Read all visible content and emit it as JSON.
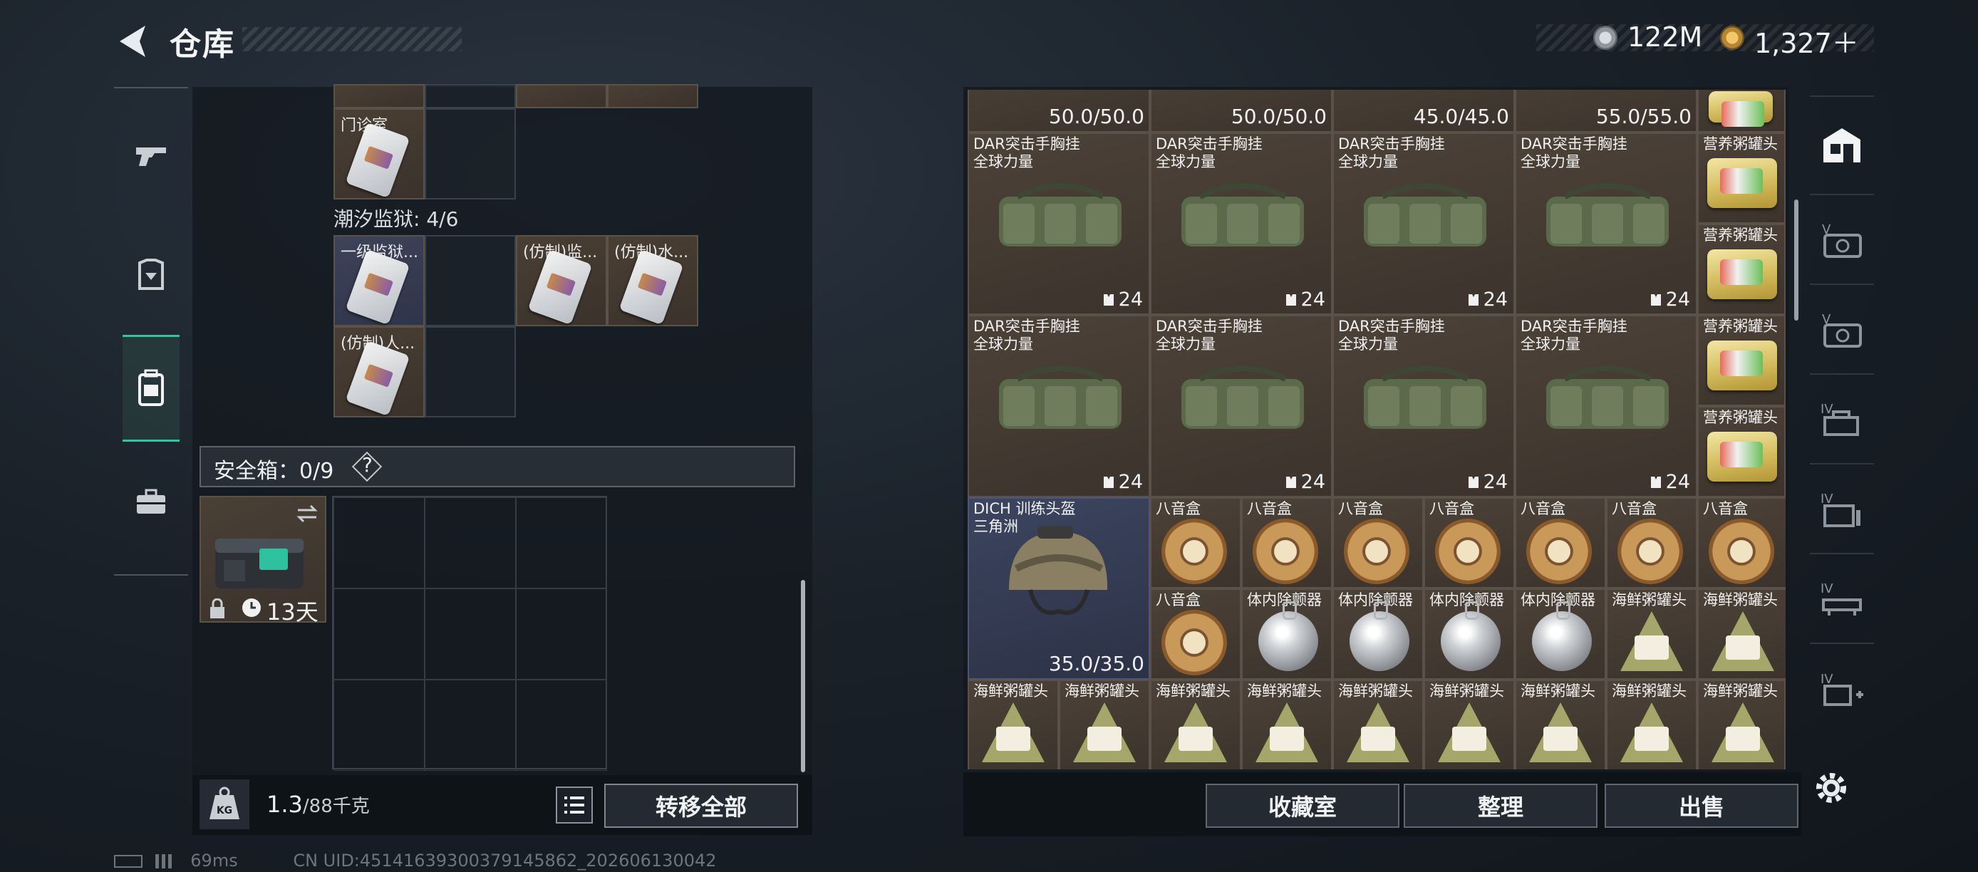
{
  "header": {
    "title": "仓库",
    "currency": [
      {
        "icon": "silver-coin-icon",
        "value": "122M"
      },
      {
        "icon": "gold-coin-icon",
        "value": "1,327＋"
      }
    ]
  },
  "left_tabs": [
    "weapon-tab",
    "armor-tab",
    "backpack-tab",
    "tools-tab"
  ],
  "stash_section": {
    "top_item_label": "门诊室",
    "prison_label": "潮汐监狱: 4/6",
    "prison_items": [
      "一级监狱...",
      "(仿制)监...",
      "(仿制)水...",
      "(仿制)人..."
    ]
  },
  "safebox": {
    "label": "安全箱：0/9",
    "help": "?",
    "item_days": "13天"
  },
  "footer_left": {
    "weight": "1.3",
    "weight_max": "/88千克",
    "transfer_all": "转移全部"
  },
  "right_grid": {
    "top_durabilities": [
      "50.0/50.0",
      "50.0/50.0",
      "45.0/45.0",
      "55.0/55.0"
    ],
    "bag_name": "DAR突击手胸挂\n全球力量",
    "bag_capacity": "24",
    "nutrition": "营养粥罐头",
    "helmet_name": "DICH 训练头盔\n三角洲",
    "helmet_durability": "35.0/35.0",
    "music_box": "八音盒",
    "tracker": "体内除颤器",
    "seafood": "海鲜粥罐头"
  },
  "footer_right": {
    "collection": "收藏室",
    "organize": "整理",
    "sell": "出售"
  },
  "right_tabs": [
    "safehouse-icon",
    "v-cabinet-icon",
    "v-cabinet-icon-2",
    "iv-cabinet-icon",
    "iv-shelf-icon",
    "iv-rack-icon",
    "iv-add-icon"
  ],
  "status_bar": {
    "ping": "69ms",
    "uid": "CN UID:45141639300379145862_202606130042"
  }
}
